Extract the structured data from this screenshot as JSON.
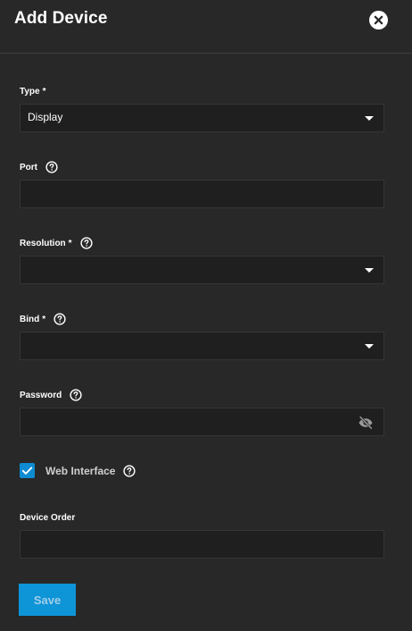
{
  "header": {
    "title": "Add Device",
    "close_icon": "close-circle-icon"
  },
  "form": {
    "type": {
      "label": "Type",
      "required_mark": "*",
      "selected_value": "Display"
    },
    "port": {
      "label": "Port",
      "value": ""
    },
    "resolution": {
      "label": "Resolution",
      "required_mark": "*",
      "selected_value": ""
    },
    "bind": {
      "label": "Bind",
      "required_mark": "*",
      "selected_value": ""
    },
    "password": {
      "label": "Password",
      "value": "",
      "visibility_icon": "eye-off-icon"
    },
    "web_interface": {
      "label": "Web Interface",
      "checked": true
    },
    "device_order": {
      "label": "Device Order",
      "value": ""
    }
  },
  "actions": {
    "save_label": "Save"
  },
  "colors": {
    "background": "#282828",
    "field_background": "#1f1f1f",
    "accent": "#0e95d8",
    "text": "#ffffff"
  }
}
